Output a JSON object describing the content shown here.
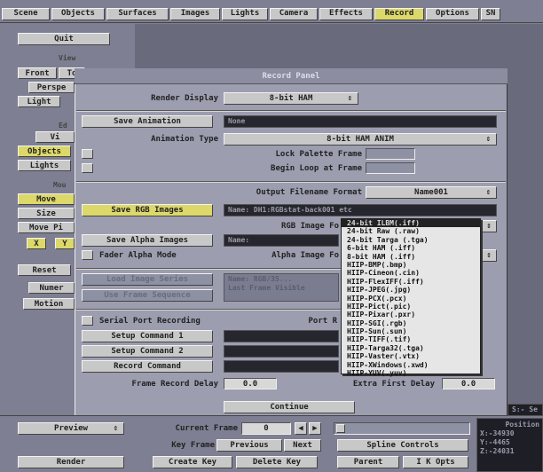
{
  "tabs": [
    "Scene",
    "Objects",
    "Surfaces",
    "Images",
    "Lights",
    "Camera",
    "Effects",
    "Record",
    "Options",
    "SN"
  ],
  "left": {
    "quit": "Quit",
    "view_header": "View",
    "front": "Front",
    "top": "To",
    "perspective": "Perspe",
    "light": "Light",
    "edit_header": "Ed",
    "view_btn": "Vi",
    "objects": "Objects",
    "lights": "Lights",
    "mouse_header": "Mou",
    "move": "Move",
    "size": "Size",
    "move_pivot": "Move Pi",
    "x": "X",
    "y": "Y",
    "reset": "Reset",
    "numeric": "Numer",
    "motion": "Motion"
  },
  "panel": {
    "title": "Record Panel",
    "render_display_label": "Render Display",
    "render_display_value": "8-bit HAM",
    "save_animation": "Save Animation",
    "anim_field": "None",
    "animation_type_label": "Animation Type",
    "animation_type_value": "8-bit HAM ANIM",
    "lock_palette_label": "Lock Palette Frame",
    "begin_loop_label": "Begin Loop at Frame",
    "output_format_label": "Output Filename Format",
    "output_format_value": "Name001",
    "save_rgb": "Save RGB Images",
    "rgb_field": "Name: DH1:RGBstat-back001 etc",
    "rgb_type_label": "RGB Image Fo",
    "save_alpha": "Save Alpha Images",
    "alpha_field": "Name:",
    "fader_alpha": "Fader Alpha Mode",
    "alpha_format_label": "Alpha Image Fo",
    "disabled_btn1": "Load Image Series",
    "disabled_btn2": "Use Frame Sequence",
    "disabled_field": "Name: RGB/35...\nLast Frame Visible",
    "serial_port": "Serial Port Recording",
    "port_label": "Port R",
    "setup_cmd1": "Setup Command 1",
    "setup_cmd2": "Setup Command 2",
    "record_cmd": "Record Command",
    "frame_record_delay": "Frame Record Delay",
    "frame_record_value": "0.0",
    "extra_first_delay": "Extra First Delay",
    "extra_first_value": "0.0",
    "continue": "Continue"
  },
  "rgb_formats": [
    "24-bit ILBM(.iff)",
    "24-bit Raw (.raw)",
    "24-bit Targa (.tga)",
    "6-bit HAM (.iff)",
    "8-bit HAM (.iff)",
    "HIIP-BMP(.bmp)",
    "HIIP-Cineon(.cin)",
    "HIIP-FlexIFF(.iff)",
    "HIIP-JPEG(.jpg)",
    "HIIP-PCX(.pcx)",
    "HIIP-Pict(.pic)",
    "HIIP-Pixar(.pxr)",
    "HIIP-SGI(.rgb)",
    "HIIP-Sun(.sun)",
    "HIIP-TIFF(.tif)",
    "HIIP-Targa32(.tga)",
    "HIIP-Vaster(.vtx)",
    "HIIP-XWindows(.xwd)",
    "HIIP-YUV(.yuv)"
  ],
  "rgb_selected_index": 0,
  "bottom": {
    "preview": "Preview",
    "current_frame_label": "Current Frame",
    "current_frame_value": "0",
    "key_frame_label": "Key Frame",
    "previous": "Previous",
    "next": "Next",
    "spline_controls": "Spline Controls",
    "render": "Render",
    "create_key": "Create Key",
    "delete_key": "Delete Key",
    "parent": "Parent",
    "ik_opts": "I K Opts",
    "position_label": "Position",
    "pos_x": "X:-34930",
    "pos_y": "Y:-4465",
    "pos_z": "Z:-24031",
    "ss_label": "S:- Se"
  },
  "colors": {
    "active_tab": "#dcd86a",
    "background": "#7e7f92",
    "panel": "#9c9daf"
  }
}
